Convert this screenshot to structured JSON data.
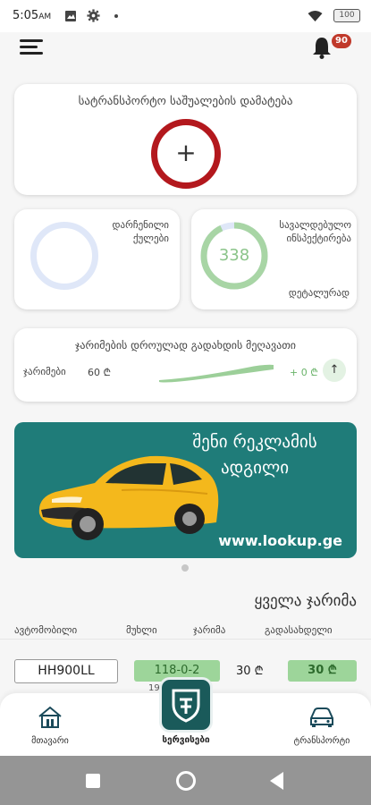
{
  "status_bar": {
    "time": "5:05",
    "ampm": "AM",
    "battery": "100"
  },
  "header": {
    "notification_count": "90"
  },
  "add_vehicle": {
    "title": "სატრანსპორტო საშუალების დამატება",
    "plus": "+"
  },
  "stats": {
    "left_label_1": "დარჩენილი",
    "left_label_2": "ქულები",
    "right_label_1": "სავალდებულო",
    "right_label_2": "ინსპექტირება",
    "right_value": "338",
    "right_bottom": "დეტალურად",
    "right_progress": 0.93
  },
  "penalty_summary": {
    "title": "ჯარიმების დროულად გადახდის მეღავათი",
    "label": "ჯარიმები",
    "amount": "60 ₾",
    "change": "+ 0 ₾",
    "up_icon": "↑"
  },
  "ad": {
    "line1": "შენი რეკლამის",
    "line2": "ადგილი",
    "url": "www.lookup.ge",
    "bg_color": "#1f7c79"
  },
  "penalties": {
    "title": "ყველა ჯარიმა",
    "columns": [
      "ავტომობილი",
      "მუხლი",
      "ჯარიმა",
      "გადასახდელი"
    ],
    "rows": [
      {
        "plate": "HH900LL",
        "article": "118-0-2",
        "fine": "30 ₾",
        "to_pay": "30 ₾",
        "date": "19"
      }
    ]
  },
  "bottom_nav": {
    "home": "მთავარი",
    "services": "სერვისები",
    "transport": "ტრანსპორტი"
  },
  "colors": {
    "accent_red": "#b3181d",
    "accent_green": "#9dd59a",
    "teal": "#1a5a5a"
  }
}
